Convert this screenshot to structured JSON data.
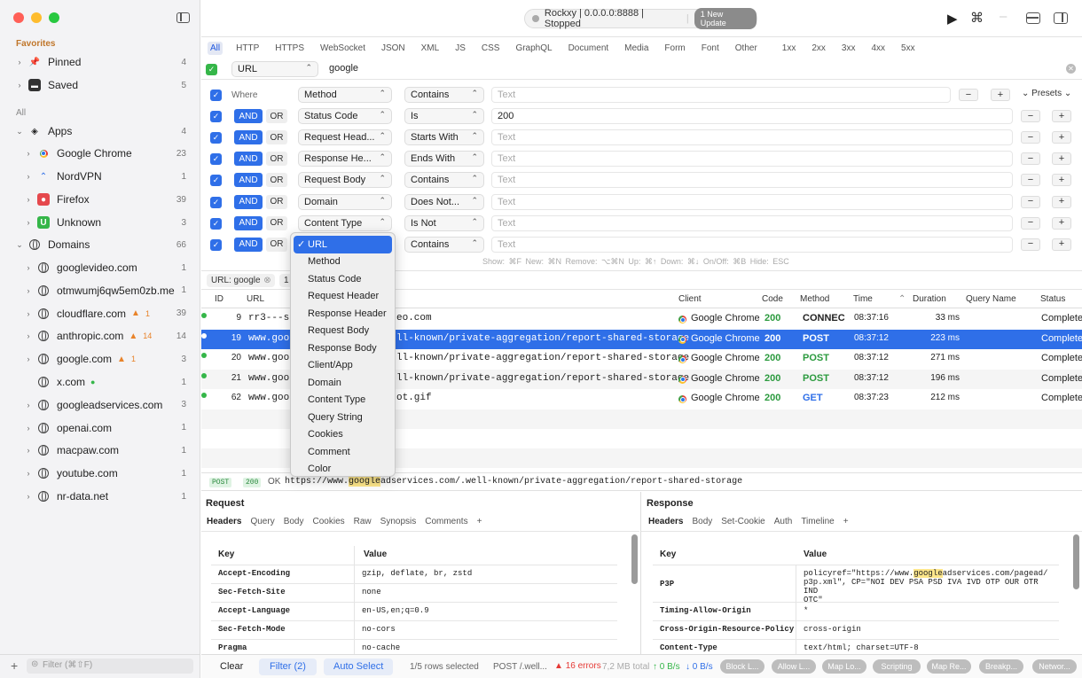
{
  "sidebar": {
    "favorites_label": "Favorites",
    "favorites": [
      {
        "label": "Pinned",
        "count": "4"
      },
      {
        "label": "Saved",
        "count": "5"
      }
    ],
    "all_label": "All",
    "apps": {
      "label": "Apps",
      "count": "4"
    },
    "app_items": [
      {
        "label": "Google Chrome",
        "count": "23"
      },
      {
        "label": "NordVPN",
        "count": "1"
      },
      {
        "label": "Firefox",
        "count": "39"
      },
      {
        "label": "Unknown",
        "count": "3"
      }
    ],
    "domains": {
      "label": "Domains",
      "count": "66"
    },
    "domain_items": [
      {
        "label": "googlevideo.com",
        "count": "1",
        "warn": ""
      },
      {
        "label": "otmwumj6qw5em0zb.me",
        "count": "1",
        "warn": ""
      },
      {
        "label": "cloudflare.com",
        "count": "39",
        "warn": "1"
      },
      {
        "label": "anthropic.com",
        "count": "14",
        "warn": "14"
      },
      {
        "label": "google.com",
        "count": "3",
        "warn": "1"
      },
      {
        "label": "x.com",
        "count": "1",
        "warn": ""
      },
      {
        "label": "googleadservices.com",
        "count": "3",
        "warn": ""
      },
      {
        "label": "openai.com",
        "count": "1",
        "warn": ""
      },
      {
        "label": "macpaw.com",
        "count": "1",
        "warn": ""
      },
      {
        "label": "youtube.com",
        "count": "1",
        "warn": ""
      },
      {
        "label": "nr-data.net",
        "count": "1",
        "warn": ""
      }
    ],
    "filter_placeholder": "Filter (⌘⇧F)"
  },
  "status": {
    "text": "Rockxy | 0.0.0.0:8888 | Stopped",
    "badge": "1 New Update"
  },
  "tabs": [
    "All",
    "HTTP",
    "HTTPS",
    "WebSocket",
    "JSON",
    "XML",
    "JS",
    "CSS",
    "GraphQL",
    "Document",
    "Media",
    "Form",
    "Font",
    "Other",
    "1xx",
    "2xx",
    "3xx",
    "4xx",
    "5xx"
  ],
  "search": {
    "field": "URL",
    "value": "google"
  },
  "rules": {
    "where_label": "Where",
    "and_label": "AND",
    "or_label": "OR",
    "presets_label": "Presets",
    "placeholder": "Text",
    "rows": [
      {
        "field": "Method",
        "op": "Contains",
        "value": ""
      },
      {
        "field": "Status Code",
        "op": "Is",
        "value": "200"
      },
      {
        "field": "Request Head...",
        "op": "Starts With",
        "value": ""
      },
      {
        "field": "Response He...",
        "op": "Ends With",
        "value": ""
      },
      {
        "field": "Request Body",
        "op": "Contains",
        "value": ""
      },
      {
        "field": "Domain",
        "op": "Does Not...",
        "value": ""
      },
      {
        "field": "Content Type",
        "op": "Is Not",
        "value": ""
      },
      {
        "field": "URL",
        "op": "Contains",
        "value": ""
      }
    ],
    "hint": "Show: ⌘F   New: ⌘N   Remove: ⌥⌘N   Up: ⌘↑   Down: ⌘↓   On/Off: ⌘B   Hide: ESC"
  },
  "active_filter": {
    "chip": "URL: google",
    "count": "1"
  },
  "dropdown": [
    "URL",
    "Method",
    "Status Code",
    "Request Header",
    "Response Header",
    "Request Body",
    "Response Body",
    "Client/App",
    "Domain",
    "Content Type",
    "Query String",
    "Cookies",
    "Comment",
    "Color"
  ],
  "table": {
    "headers": [
      "ID",
      "URL",
      "Client",
      "Code",
      "Method",
      "Time",
      "Duration",
      "Query Name",
      "Status"
    ],
    "rows": [
      {
        "id": "9",
        "url_a": "rr3---sn",
        "url_b": "eo.com",
        "client": "Google Chrome",
        "code": "200",
        "method": "CONNEC",
        "time": "08:37:16",
        "duration": "33 ms",
        "status": "Complete"
      },
      {
        "id": "19",
        "url_a": "www.goog",
        "url_b": "ll-known/private-aggregation/report-shared-storage",
        "client": "Google Chrome",
        "code": "200",
        "method": "POST",
        "time": "08:37:12",
        "duration": "223 ms",
        "status": "Complete"
      },
      {
        "id": "20",
        "url_a": "www.goog",
        "url_b": "ll-known/private-aggregation/report-shared-storage",
        "client": "Google Chrome",
        "code": "200",
        "method": "POST",
        "time": "08:37:12",
        "duration": "271 ms",
        "status": "Complete"
      },
      {
        "id": "21",
        "url_a": "www.goog",
        "url_b": "ll-known/private-aggregation/report-shared-storage",
        "client": "Google Chrome",
        "code": "200",
        "method": "POST",
        "time": "08:37:12",
        "duration": "196 ms",
        "status": "Complete"
      },
      {
        "id": "62",
        "url_a": "www.goog",
        "url_b": "ot.gif",
        "client": "Google Chrome",
        "code": "200",
        "method": "GET",
        "time": "08:37:23",
        "duration": "212 ms",
        "status": "Complete"
      }
    ]
  },
  "detail": {
    "method": "POST",
    "code": "200",
    "ok": "OK",
    "url_a": "https://www.",
    "url_hl": "google",
    "url_b": "adservices.com/.well-known/private-aggregation/report-shared-storage"
  },
  "request": {
    "title": "Request",
    "tabs": [
      "Headers",
      "Query",
      "Body",
      "Cookies",
      "Raw",
      "Synopsis",
      "Comments",
      "+"
    ],
    "key_h": "Key",
    "val_h": "Value",
    "rows": [
      {
        "k": "Accept-Encoding",
        "v": "gzip, deflate, br, zstd"
      },
      {
        "k": "Sec-Fetch-Site",
        "v": "none"
      },
      {
        "k": "Accept-Language",
        "v": "en-US,en;q=0.9"
      },
      {
        "k": "Sec-Fetch-Mode",
        "v": "no-cors"
      },
      {
        "k": "Pragma",
        "v": "no-cache"
      }
    ]
  },
  "response": {
    "title": "Response",
    "tabs": [
      "Headers",
      "Body",
      "Set-Cookie",
      "Auth",
      "Timeline",
      "+"
    ],
    "key_h": "Key",
    "val_h": "Value",
    "p3p_key": "P3P",
    "p3p_a": "policyref=\"https://www.",
    "p3p_hl": "google",
    "p3p_b": "adservices.com/pagead/",
    "p3p_c": "p3p.xml\", CP=\"NOI DEV PSA PSD IVA IVD OTP OUR OTR IND",
    "p3p_d": "OTC\"",
    "rows": [
      {
        "k": "Timing-Allow-Origin",
        "v": "*"
      },
      {
        "k": "Cross-Origin-Resource-Policy",
        "v": "cross-origin"
      },
      {
        "k": "Content-Type",
        "v": "text/html; charset=UTF-8"
      }
    ]
  },
  "bottom": {
    "clear": "Clear",
    "filter": "Filter (2)",
    "auto": "Auto Select",
    "rows_sel": "1/5 rows selected",
    "post": "POST /.well...",
    "errors": "16 errors",
    "total": "7,2 MB total",
    "up": "↑ 0 B/s",
    "down": "↓ 0 B/s",
    "pills": [
      "Block L...",
      "Allow L...",
      "Map Lo...",
      "Scripting",
      "Map Re...",
      "Breakp...",
      "Networ..."
    ]
  }
}
